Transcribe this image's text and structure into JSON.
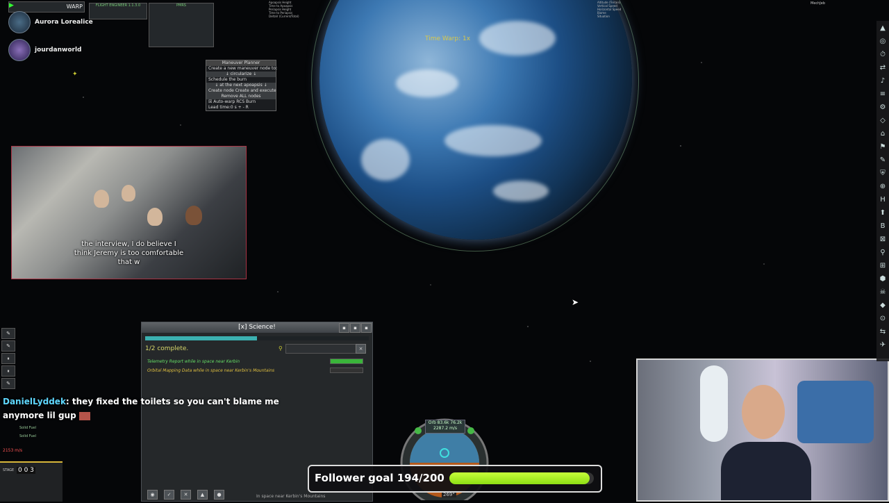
{
  "top_left": {
    "warp_label": "WARP",
    "engineer_title": "FLIGHT ENGINEER 1.1.3.0",
    "pmrs_title": "PMRS",
    "chat_users": [
      {
        "name": "Aurora Lorealice"
      },
      {
        "name": "jourdanworld"
      }
    ]
  },
  "orbit_view": {
    "time_warp_label": "Time Warp: 1x",
    "hud_left": [
      "Apoapsis Height",
      "Time to Apoapsis",
      "Periapsis Height",
      "Time to Periapsis",
      "DeltaV (Current/Total)"
    ],
    "hud_right": [
      "Altitude (Terrain)",
      "Vertical Speed",
      "Horizontal Speed",
      "Biome",
      "Situation"
    ],
    "mechjeb_label": "MechJeb"
  },
  "maneuver_planner": {
    "title": "Maneuver Planner",
    "lines": [
      "Create a new maneuver node to:",
      "↓ circularize ↓",
      "Schedule the burn",
      "↓ at the next apoapsis ↓",
      "Create node   Create and execute",
      "Remove ALL nodes",
      "☒ Auto-warp        RCS Burn",
      "Lead time:0    s + - R"
    ]
  },
  "video": {
    "caption_lines": [
      "the interview, I do believe I",
      "think Jeremy is too comfortable",
      "that w"
    ]
  },
  "science": {
    "title": "[x] Science!",
    "progress": 0.5,
    "complete_text": "1/2 complete.",
    "experiments": [
      {
        "label": "Telemetry Report while in space near Kerbin",
        "color": "#66e066",
        "progress": 1.0
      },
      {
        "label": "Orbital Mapping Data while in space near Kerbin's Mountains",
        "color": "#e0c040",
        "progress": 0.0
      }
    ],
    "status_text": "In space near Kerbin's Mountains"
  },
  "chat": {
    "username": "DanielLyddek",
    "message": "they fixed the toilets so you can't blame me anymore lil gup"
  },
  "navball": {
    "readout_top": "Orb 83.6k 76.2k",
    "speed": "2287.2 m/s",
    "heading": "269°"
  },
  "follower_goal": {
    "text": "Follower goal 194/200",
    "current": 194,
    "target": 200
  },
  "left_hud": {
    "stage_counter": "0 0 3",
    "stage_label": "STAGE",
    "speed": "2153 m/s",
    "fuel_labels": [
      "Solid Fuel",
      "Solid Fuel"
    ]
  },
  "right_toolbar": {
    "icons": [
      "▲",
      "◎",
      "⏱",
      "⇄",
      "♪",
      "≡",
      "⚙",
      "◇",
      "⌂",
      "⚑",
      "✎",
      "⛨",
      "⊕",
      "H",
      "⬆",
      "B",
      "⊠",
      "⚲",
      "⊞",
      "⬢",
      "☠",
      "◆",
      "⊙",
      "⇆",
      "✈"
    ]
  }
}
